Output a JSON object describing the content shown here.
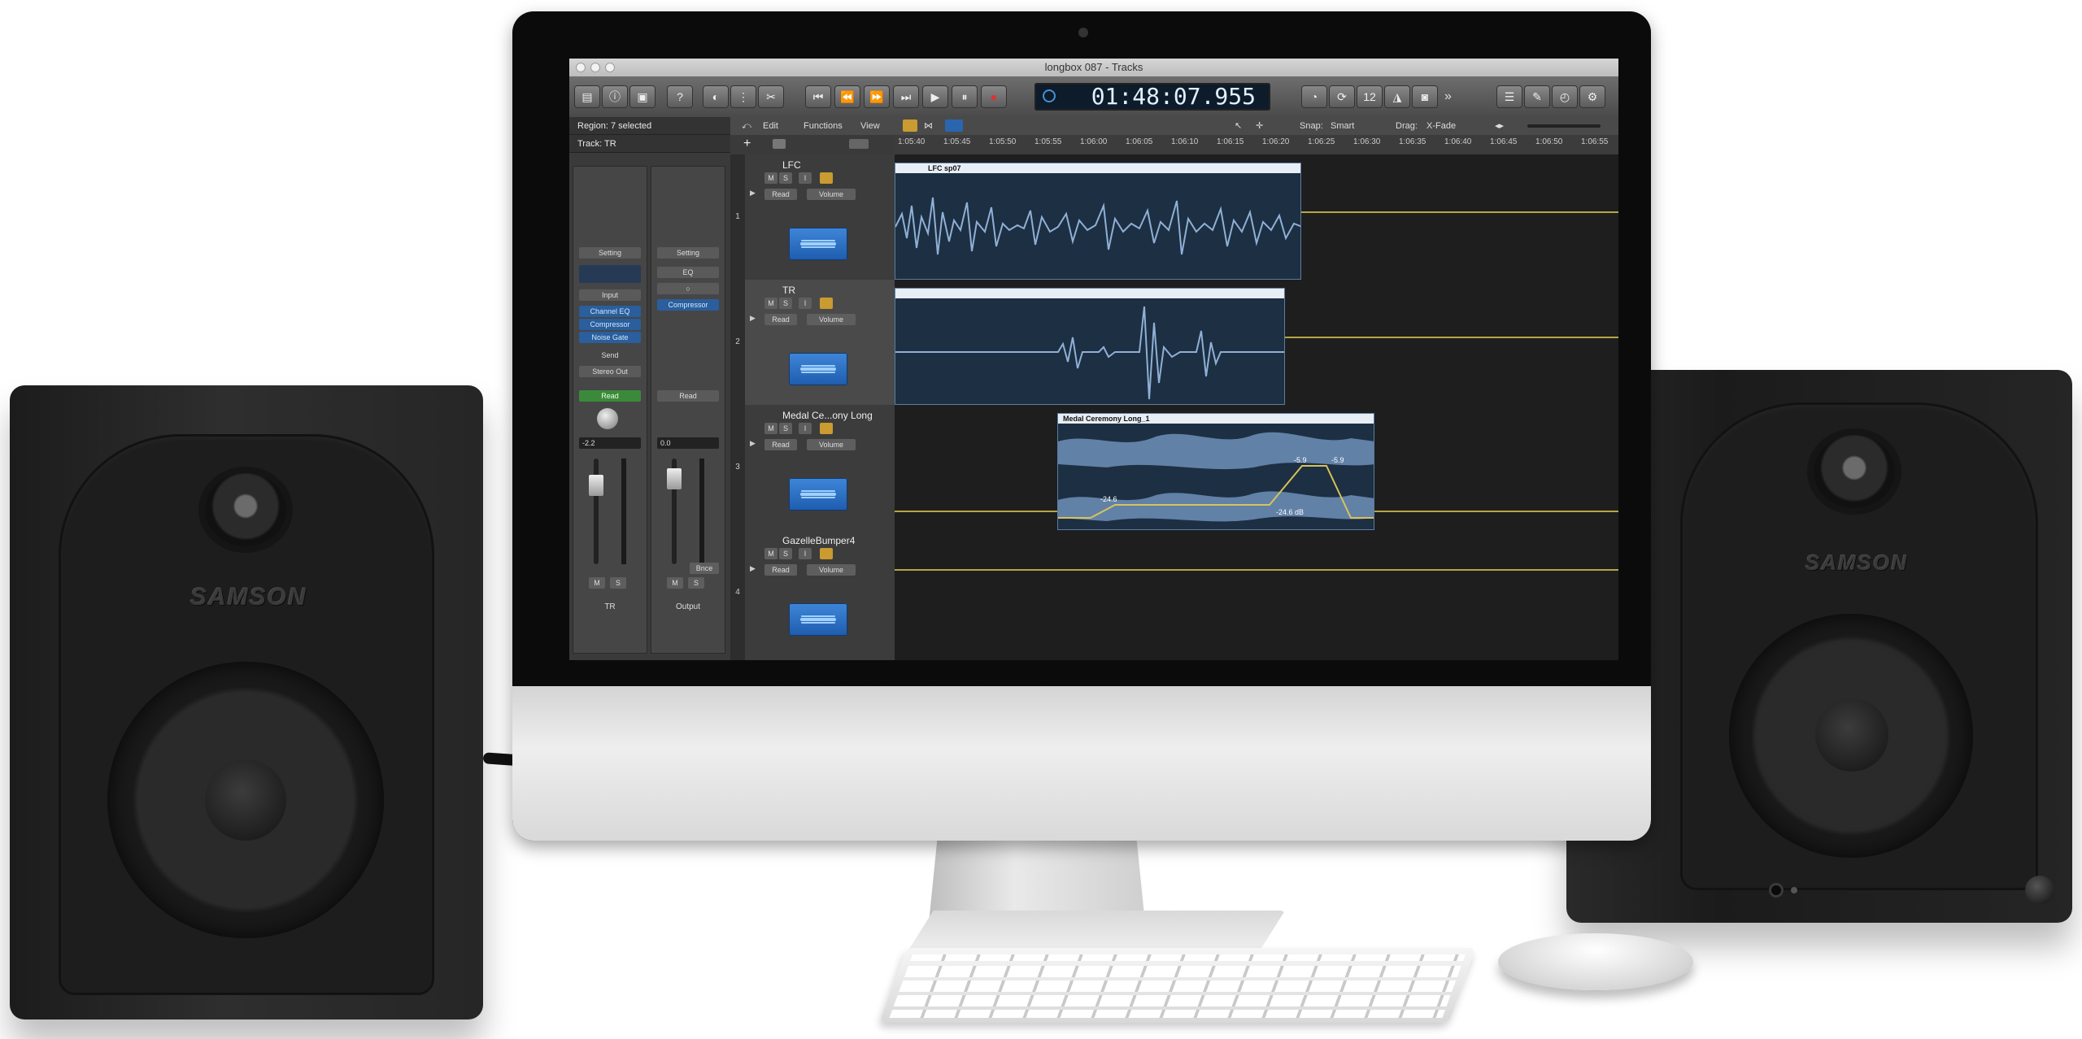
{
  "speakers": {
    "left_brand": "SAMSON",
    "right_brand": "SAMSON"
  },
  "window": {
    "title": "longbox 087 - Tracks"
  },
  "transport": {
    "time": "01:48:07.955"
  },
  "inspector": {
    "region": "Region: 7 selected",
    "track": "Track: TR",
    "strip1": {
      "setting": "Setting",
      "input": "Input",
      "plugins": [
        "Channel EQ",
        "Compressor",
        "Noise Gate"
      ],
      "send": "Send",
      "output": "Stereo Out",
      "automation": "Read",
      "volume": "-2.2",
      "mute": "M",
      "solo": "S",
      "name": "TR"
    },
    "strip2": {
      "setting": "Setting",
      "eq": "EQ",
      "plugins": [
        "Compressor"
      ],
      "automation": "Read",
      "volume": "0.0",
      "mute": "M",
      "solo": "S",
      "bounce": "Bnce",
      "name": "Output"
    }
  },
  "editbar": {
    "edit": "Edit",
    "functions": "Functions",
    "view": "View",
    "snap_label": "Snap:",
    "snap_value": "Smart",
    "drag_label": "Drag:",
    "drag_value": "X-Fade"
  },
  "ruler": {
    "ticks": [
      "1:05:40",
      "1:05:45",
      "1:05:50",
      "1:05:55",
      "1:06:00",
      "1:06:05",
      "1:06:10",
      "1:06:15",
      "1:06:20",
      "1:06:25",
      "1:06:30",
      "1:06:35",
      "1:06:40",
      "1:06:45",
      "1:06:50",
      "1:06:55"
    ]
  },
  "tracks": [
    {
      "number": "1",
      "name": "LFC",
      "mode": "Read",
      "param": "Volume",
      "mute": "M",
      "solo": "S",
      "region": "LFC sp07"
    },
    {
      "number": "2",
      "name": "TR",
      "mode": "Read",
      "param": "Volume",
      "mute": "M",
      "solo": "S",
      "region": ""
    },
    {
      "number": "3",
      "name": "Medal Ce...ony Long",
      "mode": "Read",
      "param": "Volume",
      "mute": "M",
      "solo": "S",
      "region": "Medal Ceremony Long_1",
      "automation_labels": [
        "-24.6",
        "-5.9",
        "-5.9",
        "-24.6 dB"
      ]
    },
    {
      "number": "4",
      "name": "GazelleBumper4",
      "mode": "Read",
      "param": "Volume",
      "mute": "M",
      "solo": "S",
      "region": ""
    }
  ]
}
